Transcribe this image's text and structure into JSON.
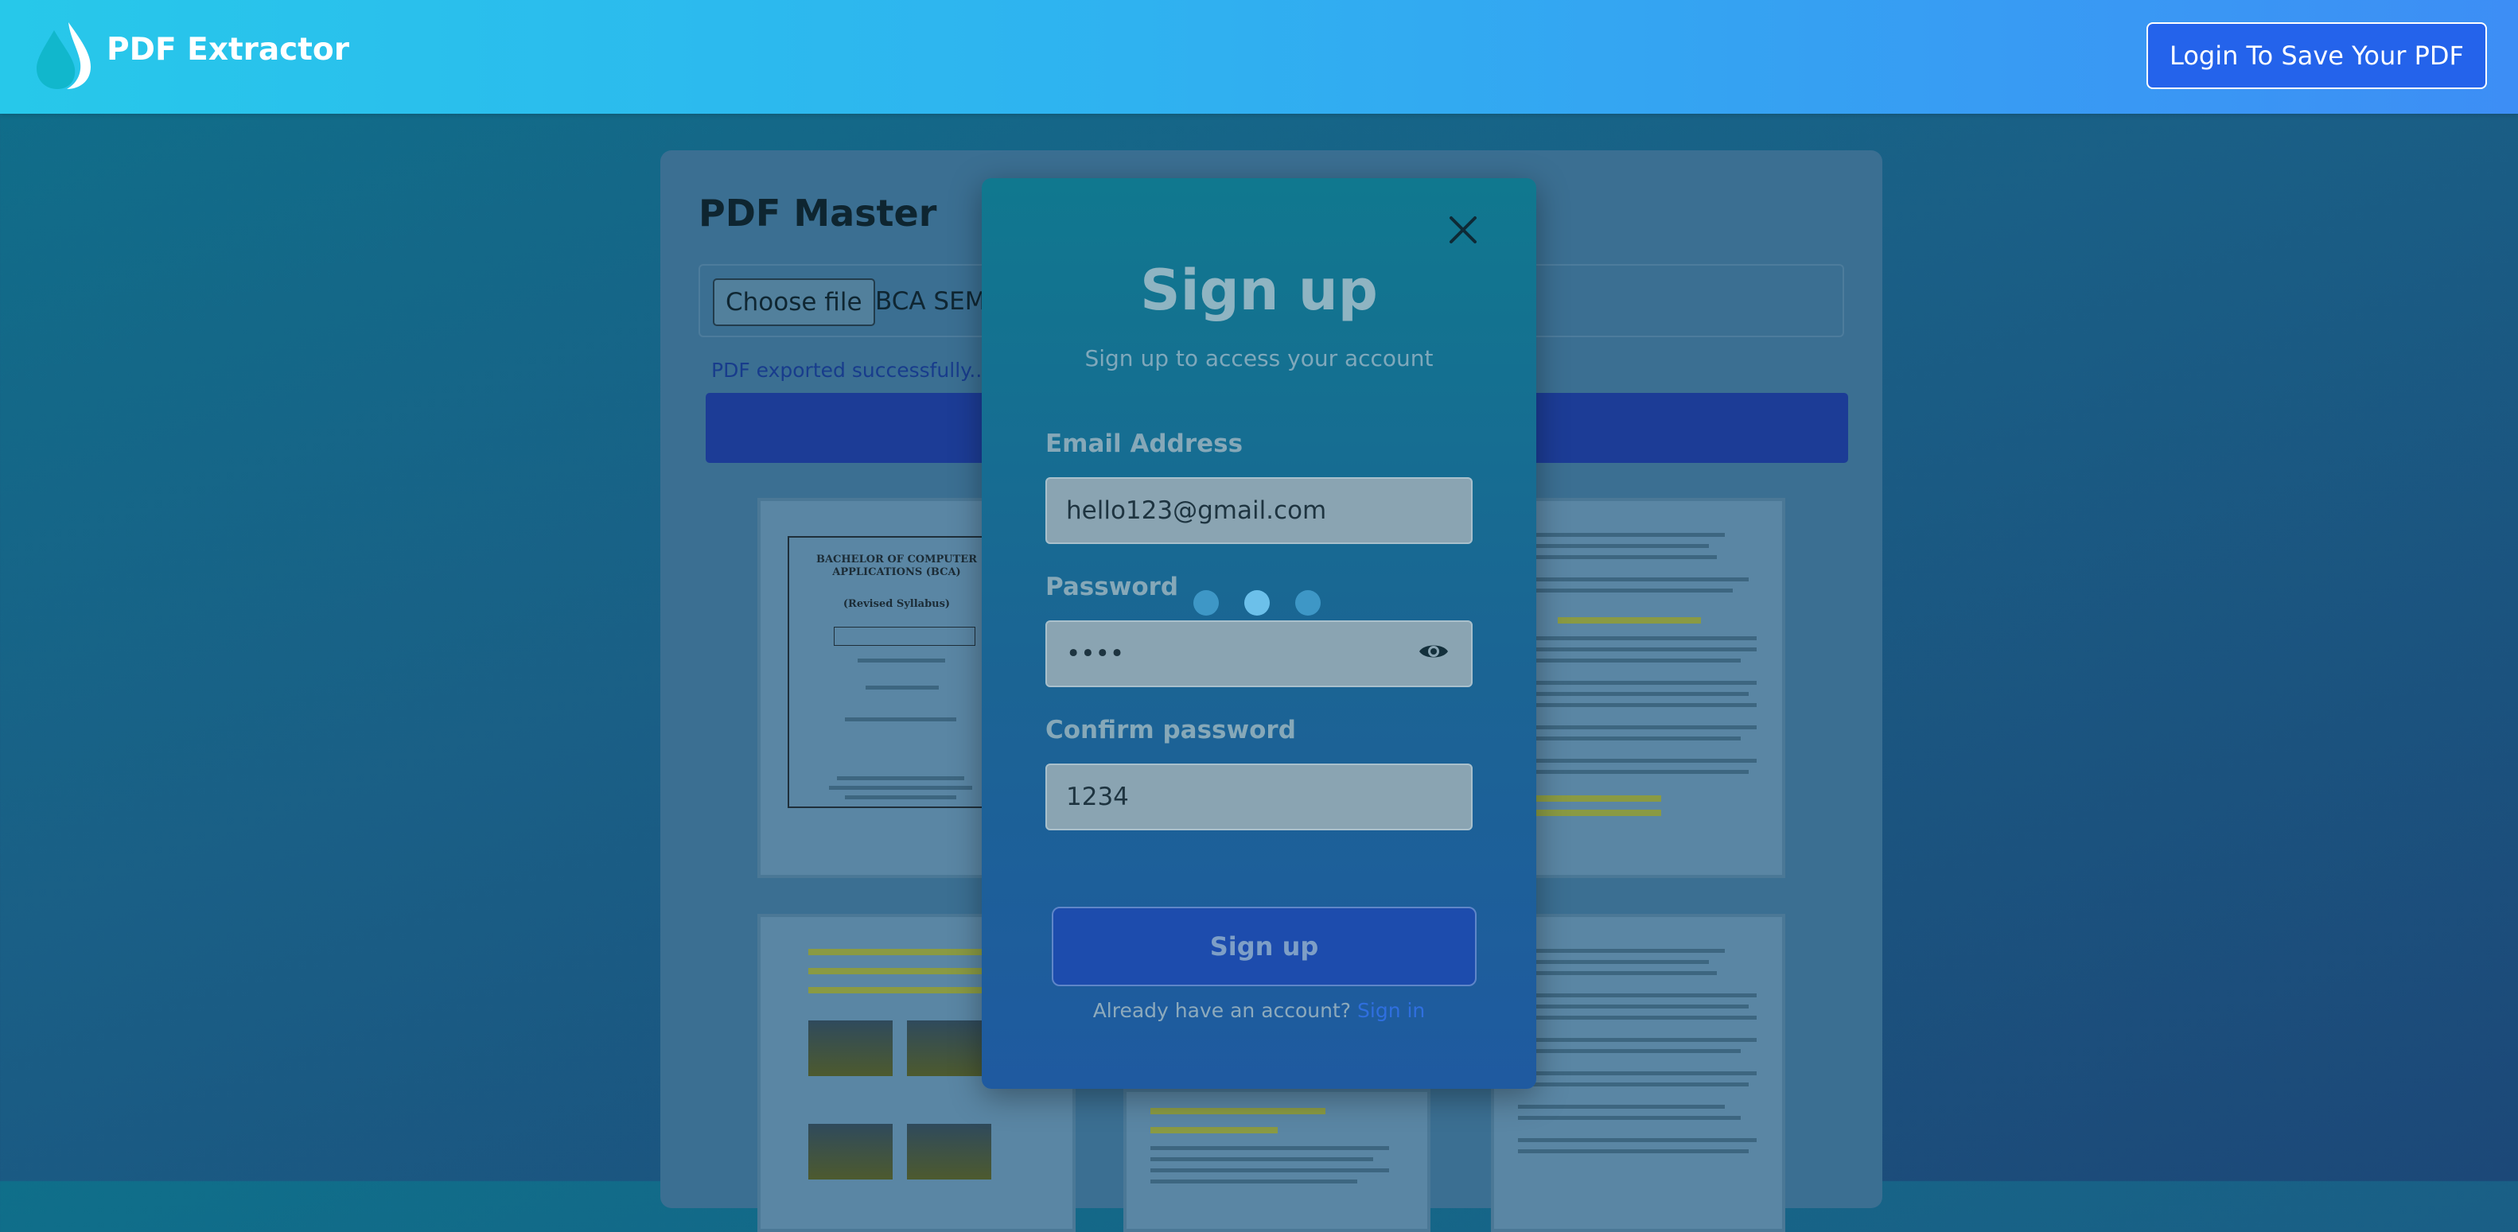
{
  "header": {
    "brand": "PDF Extractor",
    "login_button": "Login To Save Your PDF"
  },
  "background_card": {
    "title": "PDF Master",
    "choose_file_label": "Choose file",
    "file_name": "BCA SEM",
    "status_message": "PDF exported successfully...",
    "thumbnail_doc_title": "BACHELOR OF COMPUTER APPLICATIONS (BCA)",
    "thumbnail_doc_subtitle": "(Revised Syllabus)"
  },
  "modal": {
    "title": "Sign up",
    "subtitle": "Sign up to access your account",
    "email_label": "Email Address",
    "email_value": "hello123@gmail.com",
    "password_label": "Password",
    "password_value": "••••",
    "confirm_label": "Confirm password",
    "confirm_value": "1234",
    "signup_button": "Sign up",
    "already_text": "Already have an account?",
    "signin_link": "Sign in"
  },
  "colors": {
    "header_start": "#27c8ea",
    "header_end": "#3d8ef5",
    "primary_button": "#2463eb",
    "modal_top": "#10788f",
    "modal_bottom": "#1f5aa0"
  },
  "icons": [
    "water-drop-logo-icon",
    "close-icon",
    "eye-icon",
    "loading-dots"
  ]
}
